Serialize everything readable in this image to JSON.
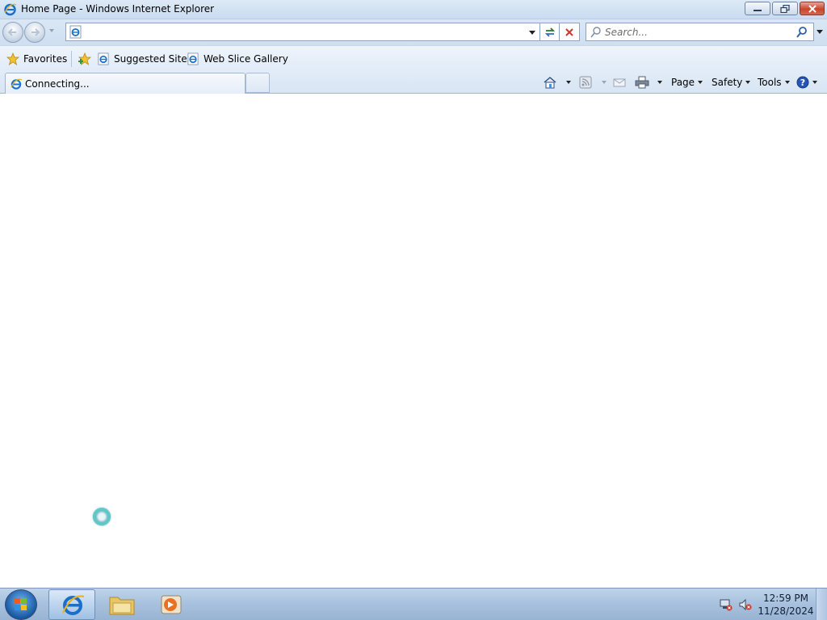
{
  "window": {
    "title": "Home Page - Windows Internet Explorer",
    "app_icon": "ie-icon"
  },
  "navbar": {
    "back_icon": "back-arrow-icon",
    "forward_icon": "forward-arrow-icon",
    "address_value": "",
    "search_placeholder": "Search..."
  },
  "favorites_bar": {
    "favorites_label": "Favorites",
    "items": [
      {
        "label": "Suggested Sites",
        "icon": "ie-page-icon"
      },
      {
        "label": "Web Slice Gallery",
        "icon": "ie-page-icon"
      }
    ]
  },
  "tabs": {
    "active_label": "Connecting..."
  },
  "commandbar": {
    "page_label": "Page",
    "safety_label": "Safety",
    "tools_label": "Tools"
  },
  "taskbar": {
    "time": "12:59 PM",
    "date": "11/28/2024"
  },
  "colors": {
    "accent": "#1d5ea8",
    "stop_red": "#d0352a"
  }
}
